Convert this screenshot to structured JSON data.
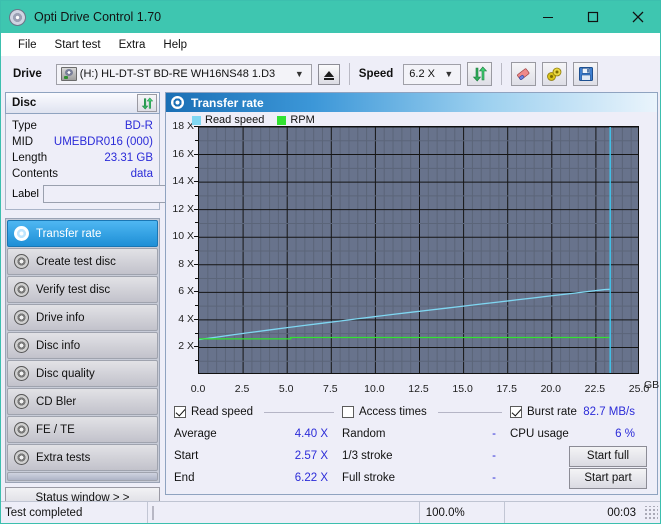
{
  "window": {
    "title": "Opti Drive Control 1.70",
    "icon": "disc-icon",
    "minimize": "minimize-icon",
    "maximize": "maximize-icon",
    "close": "close-icon",
    "titlebar_color": "#3ec6b0"
  },
  "menu": [
    {
      "label": "File"
    },
    {
      "label": "Start test"
    },
    {
      "label": "Extra"
    },
    {
      "label": "Help"
    }
  ],
  "toolbar": {
    "drive_label": "Drive",
    "drive_value": "(H:)  HL-DT-ST BD-RE  WH16NS48 1.D3",
    "eject_icon": "eject-icon",
    "speed_label": "Speed",
    "speed_value": "6.2 X",
    "refresh_icon": "refresh-icon",
    "eraser_icon": "eraser-icon",
    "tools_icon": "tools-icon",
    "save_icon": "save-icon"
  },
  "disc_panel": {
    "title": "Disc",
    "refresh_icon": "refresh-icon",
    "rows": [
      {
        "key": "Type",
        "value": "BD-R"
      },
      {
        "key": "MID",
        "value": "UMEBDR016 (000)"
      },
      {
        "key": "Length",
        "value": "23.31 GB"
      },
      {
        "key": "Contents",
        "value": "data"
      }
    ],
    "label_key": "Label",
    "label_value": "",
    "label_placeholder": "",
    "disc_button_icon": "cd-disc-icon"
  },
  "nav": {
    "items": [
      {
        "label": "Transfer rate",
        "active": true
      },
      {
        "label": "Create test disc",
        "active": false
      },
      {
        "label": "Verify test disc",
        "active": false
      },
      {
        "label": "Drive info",
        "active": false
      },
      {
        "label": "Disc info",
        "active": false
      },
      {
        "label": "Disc quality",
        "active": false
      },
      {
        "label": "CD Bler",
        "active": false
      },
      {
        "label": "FE / TE",
        "active": false
      },
      {
        "label": "Extra tests",
        "active": false
      }
    ],
    "status_button": "Status window > >"
  },
  "content": {
    "header": "Transfer rate",
    "header_icon": "disc-icon"
  },
  "chart_data": {
    "type": "line",
    "title": "Transfer rate",
    "xlabel": "GB",
    "ylabel": "X",
    "xlim": [
      0.0,
      25.0
    ],
    "ylim": [
      0,
      18
    ],
    "grid": true,
    "plot_bg": "#68738c",
    "legend_position": "top-left",
    "x_ticks": [
      "0.0",
      "2.5",
      "5.0",
      "7.5",
      "10.0",
      "12.5",
      "15.0",
      "17.5",
      "20.0",
      "22.5",
      "25.0"
    ],
    "x_tick_values": [
      0.0,
      2.5,
      5.0,
      7.5,
      10.0,
      12.5,
      15.0,
      17.5,
      20.0,
      22.5,
      25.0
    ],
    "y_ticks": [
      "2 X",
      "4 X",
      "6 X",
      "8 X",
      "10 X",
      "12 X",
      "14 X",
      "16 X",
      "18 X"
    ],
    "y_tick_values": [
      2,
      4,
      6,
      8,
      10,
      12,
      14,
      16,
      18
    ],
    "x_unit_label": "GB",
    "series": [
      {
        "name": "Read speed",
        "color": "#7fd7f2",
        "x": [
          0.0,
          1.0,
          2.0,
          3.0,
          4.0,
          5.0,
          6.0,
          7.0,
          8.0,
          9.0,
          10.0,
          11.0,
          12.0,
          13.0,
          14.0,
          15.0,
          16.0,
          17.0,
          18.0,
          19.0,
          20.0,
          21.0,
          22.0,
          23.0,
          23.31
        ],
        "values": [
          2.57,
          2.75,
          2.93,
          3.1,
          3.27,
          3.44,
          3.6,
          3.76,
          3.92,
          4.08,
          4.24,
          4.4,
          4.55,
          4.7,
          4.85,
          5.0,
          5.15,
          5.3,
          5.45,
          5.6,
          5.75,
          5.9,
          6.05,
          6.2,
          6.22
        ]
      },
      {
        "name": "RPM",
        "color": "#31e231",
        "x": [
          0.0,
          5.2,
          5.2,
          23.31
        ],
        "values": [
          2.62,
          2.62,
          2.72,
          2.72
        ]
      }
    ],
    "marker_line": {
      "x": 23.31,
      "color": "#3fc8f0"
    }
  },
  "stats": {
    "read_speed": {
      "label": "Read speed",
      "checked": true,
      "rows": [
        {
          "key": "Average",
          "value": "4.40 X"
        },
        {
          "key": "Start",
          "value": "2.57 X"
        },
        {
          "key": "End",
          "value": "6.22 X"
        }
      ]
    },
    "access_times": {
      "label": "Access times",
      "checked": false,
      "rows": [
        {
          "key": "Random",
          "value": "-"
        },
        {
          "key": "1/3 stroke",
          "value": "-"
        },
        {
          "key": "Full stroke",
          "value": "-"
        }
      ]
    },
    "burst_rate": {
      "label": "Burst rate",
      "checked": true,
      "value": "82.7 MB/s",
      "cpu_key": "CPU usage",
      "cpu_value": "6 %"
    },
    "buttons": [
      {
        "label": "Start full"
      },
      {
        "label": "Start part"
      }
    ]
  },
  "statusbar": {
    "message": "Test completed",
    "progress": 100,
    "percent": "100.0%",
    "time": "00:03",
    "progress_color": "#0aa50a"
  }
}
